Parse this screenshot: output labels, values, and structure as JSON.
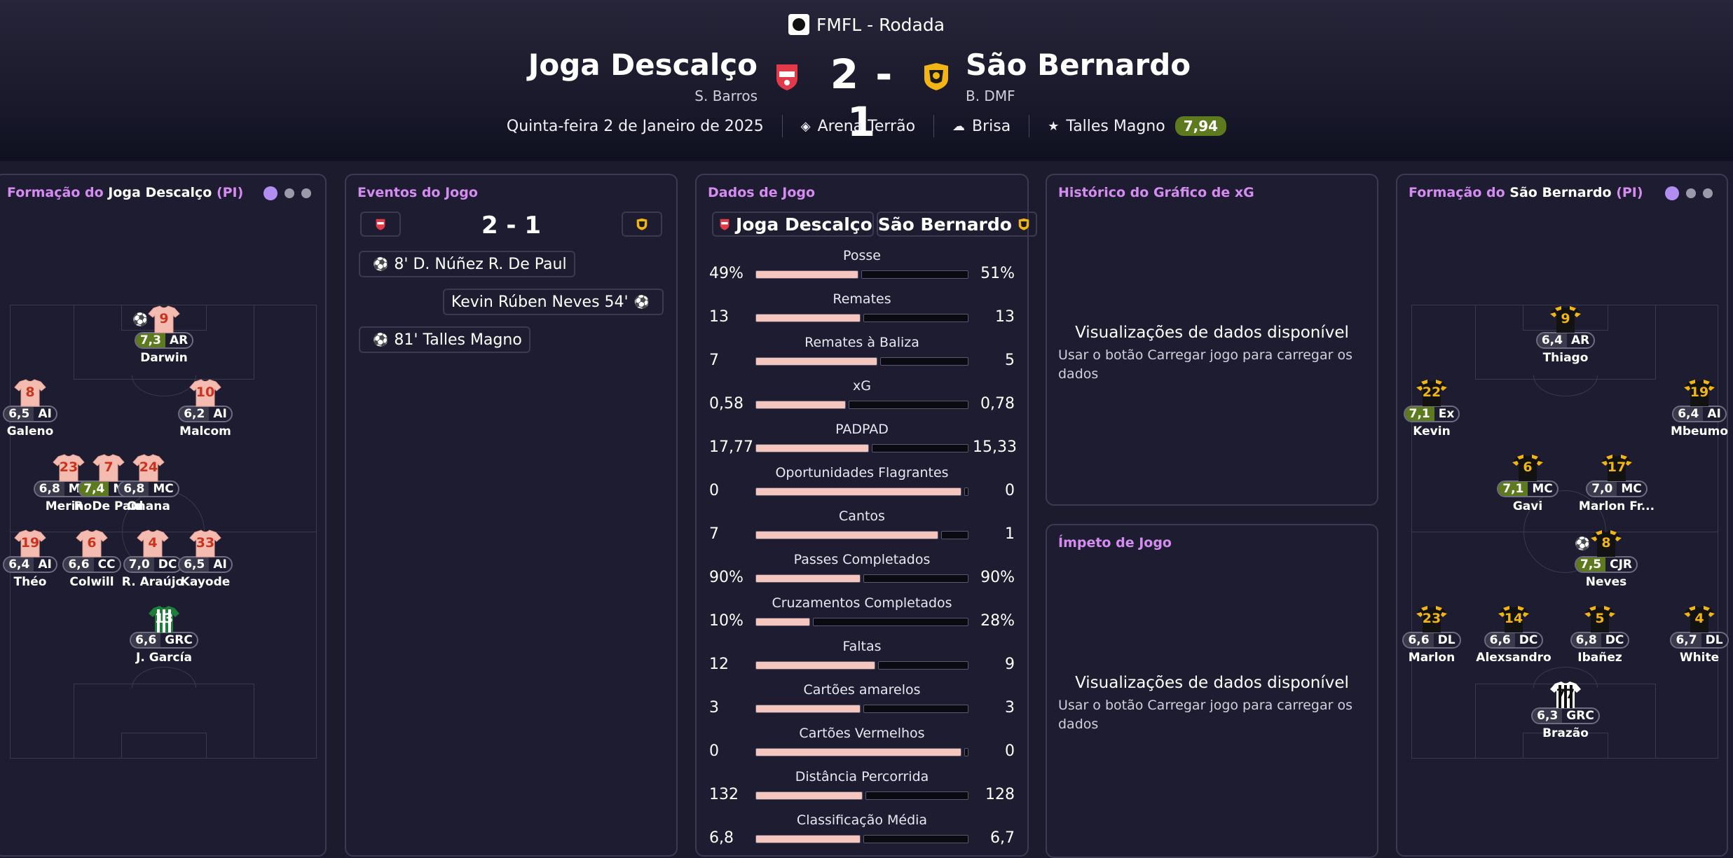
{
  "header": {
    "competition": "FMFL - Rodada",
    "home": {
      "name": "Joga Descalço",
      "manager": "S. Barros"
    },
    "away": {
      "name": "São Bernardo",
      "manager": "B. DMF"
    },
    "score": "2 - 1",
    "date": "Quinta-feira 2 de Janeiro de 2025",
    "stadium": "Arena Terrão",
    "weather": "Brisa",
    "referee": "Talles Magno",
    "referee_rating": "7,94"
  },
  "colors": {
    "accent": "#d58cf0",
    "good_rating": "#5d7a1f",
    "home_bar": "#f5c6bd"
  },
  "home_formation": {
    "title_prefix": "Formação do ",
    "team": "Joga Descalço",
    "suffix": " (PI)",
    "players": [
      {
        "num": "9",
        "rating": "7,3",
        "pos": "AR",
        "name": "Darwin",
        "good": true,
        "goal": true
      },
      {
        "num": "8",
        "rating": "6,5",
        "pos": "AI",
        "name": "Galeno"
      },
      {
        "num": "10",
        "rating": "6,2",
        "pos": "AI",
        "name": "Malcom"
      },
      {
        "num": "23",
        "rating": "6,8",
        "pos": "MCA",
        "name": "Merino"
      },
      {
        "num": "7",
        "rating": "7,4",
        "pos": "MC",
        "name": "R. De Paul",
        "good": true
      },
      {
        "num": "24",
        "rating": "6,8",
        "pos": "MC",
        "name": "Onana"
      },
      {
        "num": "19",
        "rating": "6,4",
        "pos": "AI",
        "name": "Théo"
      },
      {
        "num": "6",
        "rating": "6,6",
        "pos": "CC",
        "name": "Colwill"
      },
      {
        "num": "4",
        "rating": "7,0",
        "pos": "DC",
        "name": "R. Araújo"
      },
      {
        "num": "33",
        "rating": "6,5",
        "pos": "AI",
        "name": "Kayode"
      },
      {
        "num": "13",
        "rating": "6,6",
        "pos": "GRC",
        "name": "J. García",
        "gk": true
      }
    ]
  },
  "away_formation": {
    "title_prefix": "Formação do ",
    "team": "São Bernardo",
    "suffix": " (PI)",
    "players": [
      {
        "num": "9",
        "rating": "6,4",
        "pos": "AR",
        "name": "Thiago"
      },
      {
        "num": "22",
        "rating": "7,1",
        "pos": "Ex",
        "name": "Kevin",
        "good": true
      },
      {
        "num": "19",
        "rating": "6,4",
        "pos": "AI",
        "name": "Mbeumo"
      },
      {
        "num": "6",
        "rating": "7,1",
        "pos": "MC",
        "name": "Gavi",
        "good": true
      },
      {
        "num": "17",
        "rating": "7,0",
        "pos": "MC",
        "name": "Marlon Fr..."
      },
      {
        "num": "8",
        "rating": "7,5",
        "pos": "CJR",
        "name": "Neves",
        "good": true,
        "goal": true
      },
      {
        "num": "23",
        "rating": "6,6",
        "pos": "DL",
        "name": "Marlon"
      },
      {
        "num": "14",
        "rating": "6,6",
        "pos": "DC",
        "name": "Alexsandro"
      },
      {
        "num": "5",
        "rating": "6,8",
        "pos": "DC",
        "name": "Ibañez"
      },
      {
        "num": "4",
        "rating": "6,7",
        "pos": "DL",
        "name": "White"
      },
      {
        "num": "77",
        "rating": "6,3",
        "pos": "GRC",
        "name": "Brazão",
        "gk": true
      }
    ]
  },
  "events": {
    "title": "Eventos do Jogo",
    "score": "2 - 1",
    "items": [
      {
        "text": "8' D. Núñez R. De Paul",
        "side": "home"
      },
      {
        "text": "Kevin Rúben Neves 54'",
        "side": "away"
      },
      {
        "text": "81' Talles Magno",
        "side": "home"
      }
    ]
  },
  "stats": {
    "title": "Dados de Jogo",
    "home_tab": "Joga Descalço",
    "away_tab": "São Bernardo",
    "rows": [
      {
        "label": "Posse",
        "home": "49%",
        "away": "51%",
        "share": 0.49
      },
      {
        "label": "Remates",
        "home": "13",
        "away": "13",
        "share": 0.5
      },
      {
        "label": "Remates à Baliza",
        "home": "7",
        "away": "5",
        "share": 0.58
      },
      {
        "label": "xG",
        "home": "0,58",
        "away": "0,78",
        "share": 0.43
      },
      {
        "label": "PADPAD",
        "home": "17,77",
        "away": "15,33",
        "share": 0.54
      },
      {
        "label": "Oportunidades Flagrantes",
        "home": "0",
        "away": "0",
        "share": 0.98
      },
      {
        "label": "Cantos",
        "home": "7",
        "away": "1",
        "share": 0.87
      },
      {
        "label": "Passes Completados",
        "home": "90%",
        "away": "90%",
        "share": 0.5
      },
      {
        "label": "Cruzamentos Completados",
        "home": "10%",
        "away": "28%",
        "share": 0.26
      },
      {
        "label": "Faltas",
        "home": "12",
        "away": "9",
        "share": 0.57
      },
      {
        "label": "Cartões amarelos",
        "home": "3",
        "away": "3",
        "share": 0.5
      },
      {
        "label": "Cartões Vermelhos",
        "home": "0",
        "away": "0",
        "share": 0.98
      },
      {
        "label": "Distância Percorrida",
        "home": "132",
        "away": "128",
        "share": 0.51
      },
      {
        "label": "Classificação Média",
        "home": "6,8",
        "away": "6,7",
        "share": 0.5
      }
    ]
  },
  "xg_history": {
    "title": "Histórico do Gráfico de xG",
    "main": "Visualizações de dados disponível",
    "sub": "Usar o botão Carregar jogo para carregar os dados"
  },
  "momentum": {
    "title": "Ímpeto de Jogo",
    "main": "Visualizações de dados disponível",
    "sub": "Usar o botão Carregar jogo para carregar os dados"
  }
}
